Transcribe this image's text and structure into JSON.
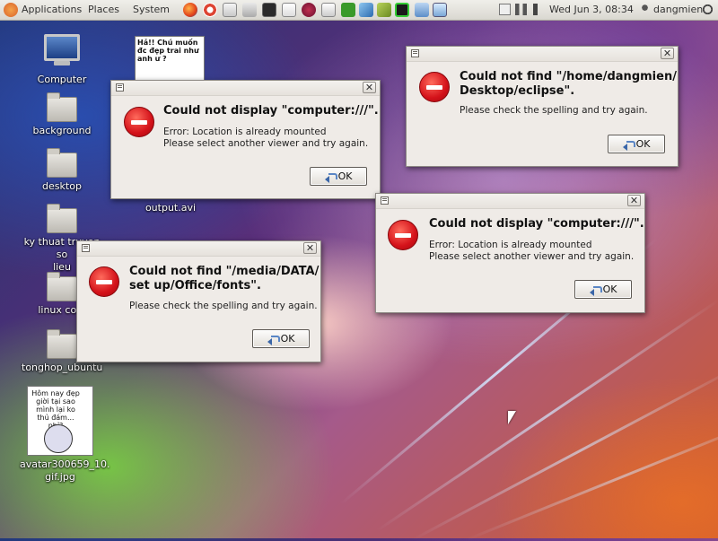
{
  "panel": {
    "applications": "Applications",
    "places": "Places",
    "system": "System",
    "clock": "Wed Jun 3, 08:34",
    "user": "dangmien",
    "launchers": [
      "firefox-icon",
      "help-icon",
      "mail-icon",
      "terminal-icon",
      "editor-icon",
      "pidgin-icon",
      "db-icon",
      "network-icon",
      "bookmark-icon",
      "chip-icon",
      "ide-icon",
      "image-icon"
    ]
  },
  "desktop": {
    "computer": "Computer",
    "background": "background",
    "desktop": "desktop",
    "ky_thuat": "ky thuat truyen so\nlieu",
    "linux": "linux co b",
    "tonghop": "tonghop_ubuntu",
    "output": "output.avi",
    "avatar": "avatar300659_10.\ngif.jpg",
    "thumb_top_text": "Hả!! Chú muốn đc đẹp trai như anh ư ?",
    "thumb_bottom_text": "Hôm nay đẹp giời tại sao mình lại ko thủ đám... nhỉ?"
  },
  "dialogs": [
    {
      "title": "Could not display \"computer:///\".",
      "body": "Error: Location is already mounted\nPlease select another viewer and try again.",
      "ok": "OK"
    },
    {
      "title": "Could not find \"/home/dangmien/\nDesktop/eclipse\".",
      "body": "Please check the spelling and try again.",
      "ok": "OK"
    },
    {
      "title": "Could not display \"computer:///\".",
      "body": "Error: Location is already mounted\nPlease select another viewer and try again.",
      "ok": "OK"
    },
    {
      "title": "Could not find \"/media/DATA/\nset up/Office/fonts\".",
      "body": "Please check the spelling and try again.",
      "ok": "OK"
    }
  ],
  "close_glyph": "✕"
}
